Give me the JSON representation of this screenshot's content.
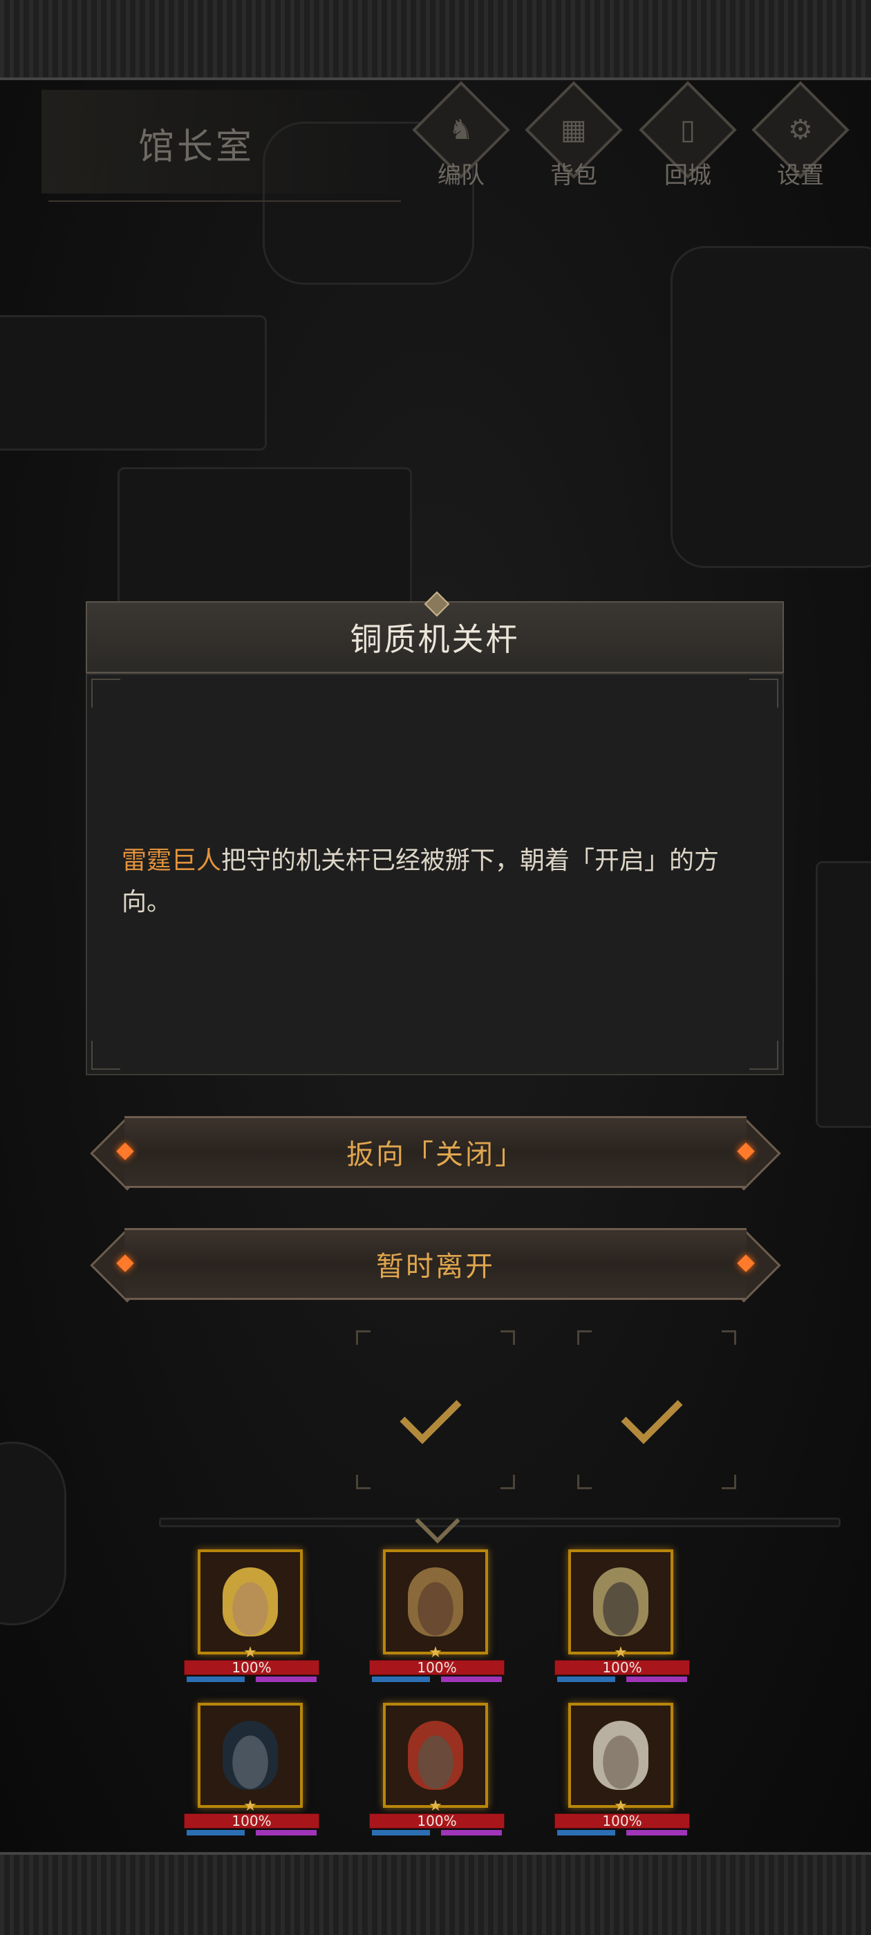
{
  "header": {
    "room_name": "馆长室",
    "menu": [
      {
        "label": "编队",
        "icon": "helmet-icon",
        "glyph": "♞"
      },
      {
        "label": "背包",
        "icon": "backpack-icon",
        "glyph": "▦"
      },
      {
        "label": "回城",
        "icon": "door-icon",
        "glyph": "▯"
      },
      {
        "label": "设置",
        "icon": "gear-icon",
        "glyph": "⚙"
      }
    ]
  },
  "dialog": {
    "title": "铜质机关杆",
    "text_highlight": "雷霆巨人",
    "text_rest": "把守的机关杆已经被掰下，朝着「开启」的方向。"
  },
  "choices": [
    {
      "label": "扳向「关闭」"
    },
    {
      "label": "暂时离开"
    }
  ],
  "party": [
    {
      "hp": "100%",
      "hair": "#c9a23a",
      "skin": "#b88f55"
    },
    {
      "hp": "100%",
      "hair": "#8a6a3a",
      "skin": "#6a4a30"
    },
    {
      "hp": "100%",
      "hair": "#9a8a5a",
      "skin": "#5a5040"
    },
    {
      "hp": "100%",
      "hair": "#1e2a36",
      "skin": "#4a5560"
    },
    {
      "hp": "100%",
      "hair": "#9a3020",
      "skin": "#6a4a3a"
    },
    {
      "hp": "100%",
      "hair": "#b8b0a0",
      "skin": "#8a7e70"
    }
  ],
  "colors": {
    "highlight": "#e4933c",
    "button_text": "#e0a64e",
    "hp_bar": "#a8161c"
  }
}
